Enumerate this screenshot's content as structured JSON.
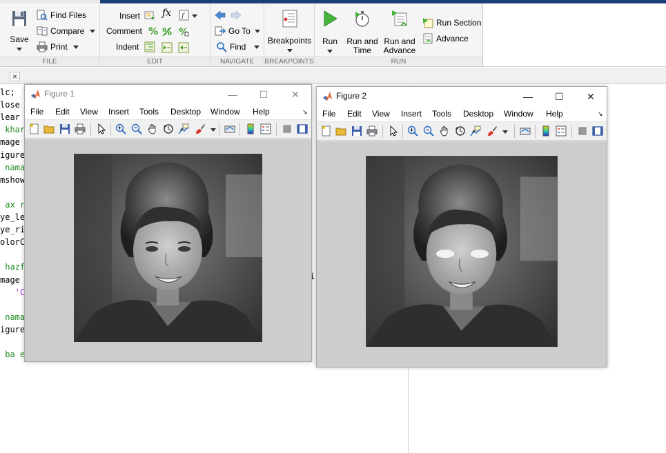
{
  "ribbon": {
    "file": {
      "label": "FILE",
      "save": "Save",
      "find_files": "Find Files",
      "compare": "Compare",
      "print": "Print"
    },
    "edit": {
      "label": "EDIT",
      "insert": "Insert",
      "comment": "Comment",
      "indent": "Indent",
      "fx": "fx"
    },
    "navigate": {
      "label": "NAVIGATE",
      "go_to": "Go To",
      "find": "Find"
    },
    "breakpoints": {
      "label": "BREAKPOINTS",
      "breakpoints": "Breakpoints"
    },
    "run": {
      "label": "RUN",
      "run": "Run",
      "run_and_time_1": "Run and",
      "run_and_time_2": "Time",
      "run_and_advance_1": "Run and",
      "run_and_advance_2": "Advance",
      "run_section": "Run Section",
      "advance": "Advance"
    }
  },
  "editor": {
    "tab_close": "×",
    "lines": [
      {
        "text": "lc;",
        "kind": "code"
      },
      {
        "text": "lose",
        "kind": "code"
      },
      {
        "text": "lear",
        "kind": "code"
      },
      {
        "text": " khar",
        "kind": "cm"
      },
      {
        "text": "mage",
        "kind": "code"
      },
      {
        "text": "igure",
        "kind": "code"
      },
      {
        "text": " nama",
        "kind": "cm"
      },
      {
        "text": "mshow",
        "kind": "code"
      },
      {
        "text": "",
        "kind": "code"
      },
      {
        "text": " ax r",
        "kind": "cm"
      },
      {
        "text": "ye_le",
        "kind": "code"
      },
      {
        "text": "ye_ri",
        "kind": "code"
      },
      {
        "text": "olorC",
        "kind": "code"
      },
      {
        "text": "",
        "kind": "code"
      },
      {
        "text": " hazf",
        "kind": "cm"
      },
      {
        "text": "mage ",
        "kind": "code"
      },
      {
        "text": "   'C",
        "kind": "str"
      },
      {
        "text": "",
        "kind": "code"
      },
      {
        "text": " nama",
        "kind": "cm"
      },
      {
        "text": "igure",
        "kind": "code"
      },
      {
        "text": "",
        "kind": "code"
      },
      {
        "text": " ba e",
        "kind": "cm"
      }
    ],
    "fragment": "i("
  },
  "figure1": {
    "title": "Figure 1",
    "menu": [
      "File",
      "Edit",
      "View",
      "Insert",
      "Tools",
      "Desktop",
      "Window",
      "Help"
    ],
    "minimize": "—",
    "maximize": "☐",
    "close": "✕"
  },
  "figure2": {
    "title": "Figure 2",
    "menu": [
      "File",
      "Edit",
      "View",
      "Insert",
      "Tools",
      "Desktop",
      "Window",
      "Help"
    ],
    "minimize": "—",
    "maximize": "☐",
    "close": "✕"
  },
  "colors": {
    "matlab_orange": "#e16737",
    "accent_blue": "#1b3f78",
    "comment_green": "#228b22",
    "string_purple": "#a020f0"
  }
}
